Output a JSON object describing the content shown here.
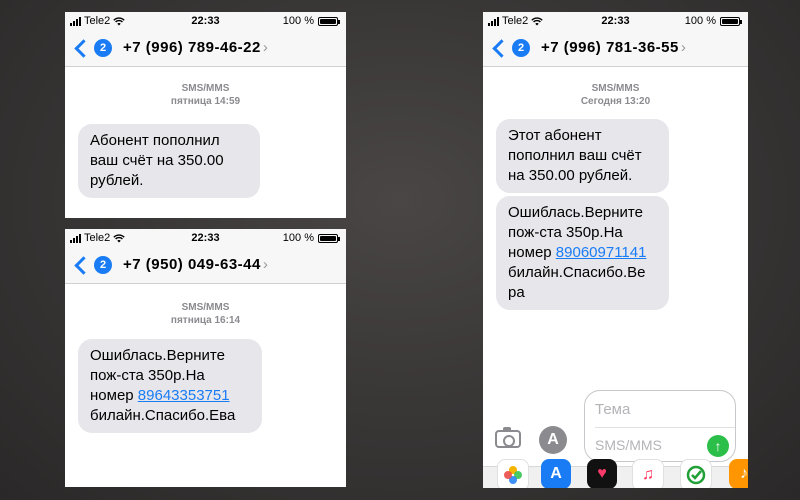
{
  "status": {
    "carrier": "Tele2",
    "time": "22:33",
    "battery": "100 %"
  },
  "screens": [
    {
      "badge": "2",
      "contact": "+7 (996) 789-46-22",
      "service": "SMS/MMS",
      "date": "пятница 14:59",
      "messages": [
        "Абонент пополнил ваш счёт на 350.00 рублей."
      ]
    },
    {
      "badge": "2",
      "contact": "+7 (950) 049-63-44",
      "service": "SMS/MMS",
      "date": "пятница 16:14",
      "message_before": "Ошиблась.Верните пож-ста 350р.На номер",
      "link": "89643353751",
      "message_after": "билайн.Спасибо.Ева"
    },
    {
      "badge": "2",
      "contact": "+7 (996) 781-36-55",
      "service": "SMS/MMS",
      "date": "Сегодня 13:20",
      "messages": [
        "Этот абонент пополнил ваш счёт на 350.00 рублей."
      ],
      "message_before": "Ошиблась.Верните пож-ста 350р.На номер",
      "link": "89060971141",
      "message_after": "билайн.Спасибо.Ве ра",
      "composer": {
        "subject_placeholder": "Тема",
        "message_placeholder": "SMS/MMS"
      }
    }
  ],
  "colors": {
    "accent": "#1a7cf5",
    "bubble": "#e6e6eb",
    "send": "#2bbf4a"
  },
  "icons": [
    "signal-icon",
    "wifi-icon",
    "battery-icon",
    "back-chevron-icon",
    "camera-icon",
    "appstore-icon",
    "send-arrow-icon",
    "photos-icon",
    "heart-app-icon",
    "music-icon",
    "sberbank-icon"
  ]
}
